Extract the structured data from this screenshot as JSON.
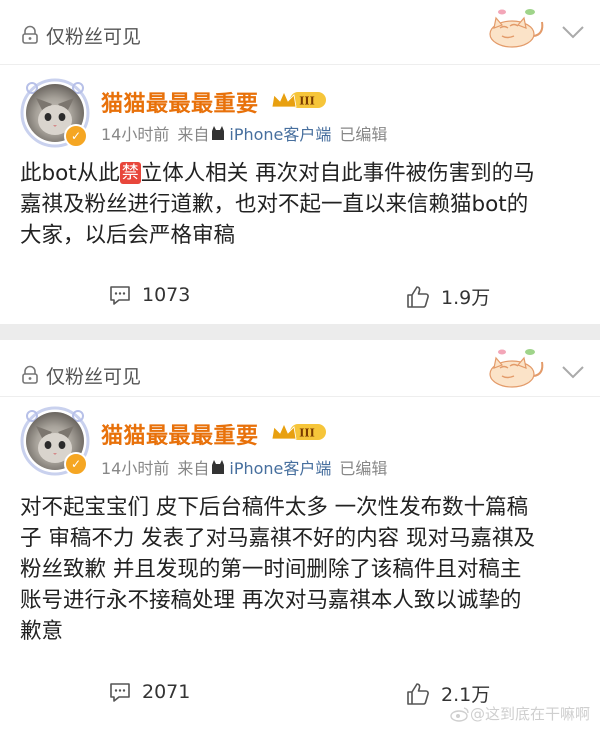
{
  "posts": [
    {
      "visibility": "仅粉丝可见",
      "username": "猫猫最最最重要",
      "level_badge": "III",
      "time": "14小时前",
      "source_prefix": "来自",
      "source": "iPhone客户端",
      "edited": "已编辑",
      "lines": [
        [
          "此bot从此",
          "禁",
          "立体人相关 再次对自此事件被伤害到的马"
        ],
        "嘉祺及粉丝进行道歉，也对不起一直以来信赖猫bot的",
        "大家，以后会严格审稿"
      ],
      "comments": "1073",
      "likes": "1.9万"
    },
    {
      "visibility": "仅粉丝可见",
      "username": "猫猫最最最重要",
      "level_badge": "III",
      "time": "14小时前",
      "source_prefix": "来自",
      "source": "iPhone客户端",
      "edited": "已编辑",
      "lines": [
        "对不起宝宝们 皮下后台稿件太多 一次性发布数十篇稿",
        "子 审稿不力 发表了对马嘉祺不好的内容 现对马嘉祺及",
        "粉丝致歉 并且发现的第一时间删除了该稿件且对稿主",
        "账号进行永不接稿处理 再次对马嘉祺本人致以诚挚的",
        "歉意"
      ],
      "comments": "2071",
      "likes": "2.1万"
    }
  ],
  "watermark": "@这到底在干嘛啊",
  "colors": {
    "username": "#e8710a",
    "source_link": "#476f9e",
    "ban_badge": "#e8463b",
    "verify_badge": "#f5a623"
  },
  "icons": [
    "lock-icon",
    "cat-sticker-icon",
    "chevron-down-icon",
    "verified-icon",
    "vip-crown-icon",
    "comment-icon",
    "like-icon",
    "weibo-logo-icon"
  ]
}
